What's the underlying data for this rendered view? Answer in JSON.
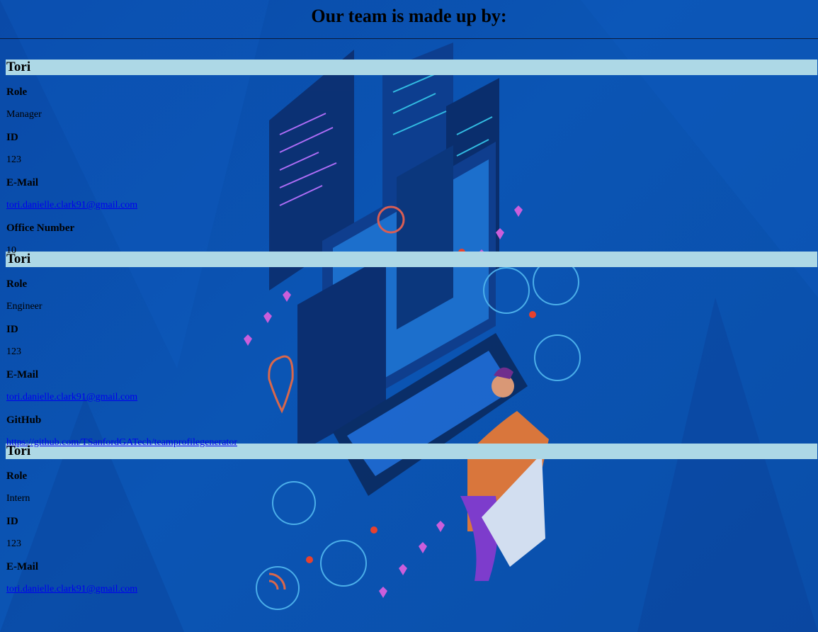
{
  "header": {
    "title": "Our team is made up by:"
  },
  "team": [
    {
      "name": "Tori",
      "fields": [
        {
          "label": "Role",
          "value": "Manager",
          "link": false
        },
        {
          "label": "ID",
          "value": "123",
          "link": false
        },
        {
          "label": "E-Mail",
          "value": "tori.danielle.clark91@gmail.com",
          "link": true
        },
        {
          "label": "Office Number",
          "value": "10",
          "link": false
        }
      ]
    },
    {
      "name": "Tori",
      "fields": [
        {
          "label": "Role",
          "value": "Engineer",
          "link": false
        },
        {
          "label": "ID",
          "value": "123",
          "link": false
        },
        {
          "label": "E-Mail",
          "value": "tori.danielle.clark91@gmail.com",
          "link": true
        },
        {
          "label": "GitHub",
          "value": "https://github.com/TSanfordGATech/teamprofilegenerator",
          "link": true
        }
      ]
    },
    {
      "name": "Tori",
      "fields": [
        {
          "label": "Role",
          "value": "Intern",
          "link": false
        },
        {
          "label": "ID",
          "value": "123",
          "link": false
        },
        {
          "label": "E-Mail",
          "value": "tori.danielle.clark91@gmail.com",
          "link": true
        }
      ]
    }
  ],
  "colors": {
    "background": "#0b52b0",
    "name_bar": "#add8e6",
    "link": "#0000ee"
  }
}
